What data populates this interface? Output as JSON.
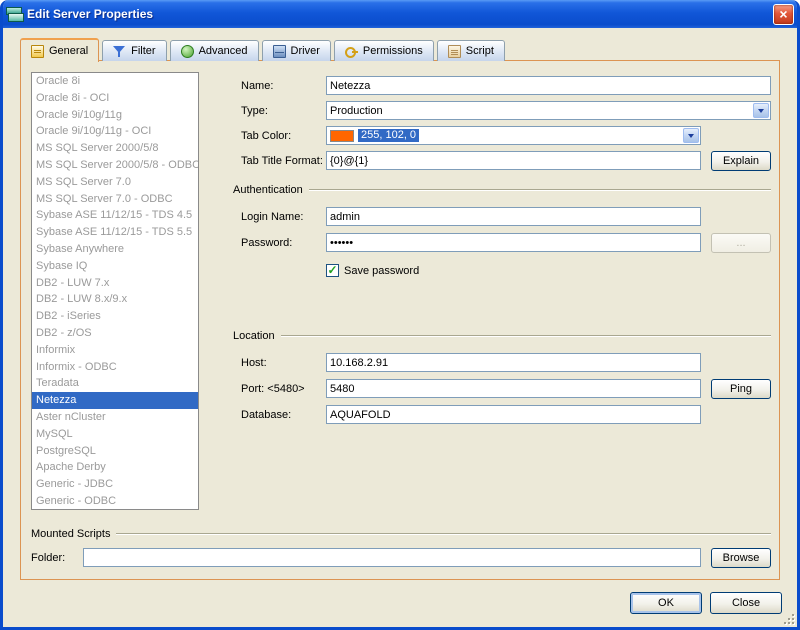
{
  "window": {
    "title": "Edit Server Properties",
    "close_glyph": "×"
  },
  "tabs": [
    {
      "label": "General"
    },
    {
      "label": "Filter"
    },
    {
      "label": "Advanced"
    },
    {
      "label": "Driver"
    },
    {
      "label": "Permissions"
    },
    {
      "label": "Script"
    }
  ],
  "server_list": {
    "selected_index": 19,
    "items": [
      "Oracle 8i",
      "Oracle 8i - OCI",
      "Oracle 9i/10g/11g",
      "Oracle 9i/10g/11g - OCI",
      "MS SQL Server 2000/5/8",
      "MS SQL Server 2000/5/8 - ODBC",
      "MS SQL Server 7.0",
      "MS SQL Server 7.0 - ODBC",
      "Sybase ASE 11/12/15 - TDS 4.5",
      "Sybase ASE 11/12/15 - TDS 5.5",
      "Sybase Anywhere",
      "Sybase IQ",
      "DB2 - LUW 7.x",
      "DB2 - LUW 8.x/9.x",
      "DB2 - iSeries",
      "DB2 - z/OS",
      "Informix",
      "Informix - ODBC",
      "Teradata",
      "Netezza",
      "Aster nCluster",
      "MySQL",
      "PostgreSQL",
      "Apache Derby",
      "Generic - JDBC",
      "Generic - ODBC"
    ]
  },
  "general": {
    "name_label": "Name:",
    "name_value": "Netezza",
    "type_label": "Type:",
    "type_value": "Production",
    "tab_color_label": "Tab Color:",
    "tab_color_value": "255, 102, 0",
    "tab_color_hex": "#ff6600",
    "tab_title_label": "Tab Title Format:",
    "tab_title_value": "{0}@{1}",
    "explain_button": "Explain"
  },
  "authentication": {
    "title": "Authentication",
    "login_label": "Login Name:",
    "login_value": "admin",
    "password_label": "Password:",
    "password_value": "••••••",
    "ellipsis_button": "...",
    "save_password_label": "Save password",
    "checkbox_glyph": "✓"
  },
  "location": {
    "title": "Location",
    "host_label": "Host:",
    "host_value": "10.168.2.91",
    "port_label": "Port: <5480>",
    "port_value": "5480",
    "ping_button": "Ping",
    "database_label": "Database:",
    "database_value": "AQUAFOLD"
  },
  "mounted_scripts": {
    "title": "Mounted Scripts",
    "folder_label": "Folder:",
    "folder_value": "",
    "browse_button": "Browse"
  },
  "footer": {
    "ok_button": "OK",
    "close_button": "Close"
  }
}
